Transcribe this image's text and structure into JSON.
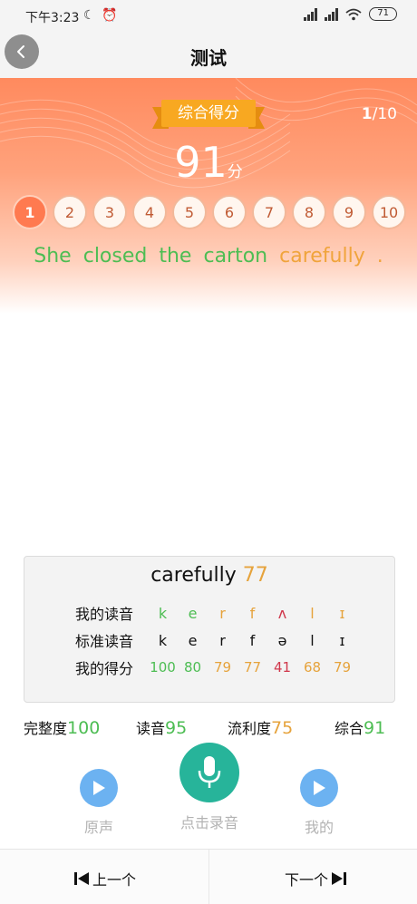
{
  "status_bar": {
    "time": "下午3:23",
    "icons": [
      "moon-icon",
      "alarm-icon",
      "signal-icon",
      "signal-icon",
      "wifi-icon"
    ],
    "battery": "71"
  },
  "header": {
    "title": "测试",
    "back_icon": "chevron-left-icon"
  },
  "result": {
    "badge": "综合得分",
    "progress_current": "1",
    "progress_total": "/10",
    "score": "91",
    "score_unit": "分",
    "questions": [
      "1",
      "2",
      "3",
      "4",
      "5",
      "6",
      "7",
      "8",
      "9",
      "10"
    ],
    "active_question": "1",
    "sentence": [
      {
        "text": "She",
        "color": "#4dbd53"
      },
      {
        "text": "closed",
        "color": "#4dbd53"
      },
      {
        "text": "the",
        "color": "#4dbd53"
      },
      {
        "text": "carton",
        "color": "#4dbd53"
      },
      {
        "text": "carefully",
        "color": "#f0a43c"
      },
      {
        "text": ".",
        "color": "#f0a43c"
      }
    ]
  },
  "detail": {
    "word": "carefully",
    "word_score": "77",
    "my_label": "我的读音",
    "std_label": "标准读音",
    "score_label": "我的得分",
    "my_phonemes": [
      "k",
      "e",
      "r",
      "f",
      "ʌ",
      "l",
      "ɪ"
    ],
    "my_colors": [
      "#4dbd53",
      "#4dbd53",
      "#e6a33c",
      "#e6a33c",
      "#d0384c",
      "#e6a33c",
      "#e6a33c"
    ],
    "std_phonemes": [
      "k",
      "e",
      "r",
      "f",
      "ə",
      "l",
      "ɪ"
    ],
    "scores": [
      "100",
      "80",
      "79",
      "77",
      "41",
      "68",
      "79"
    ],
    "score_colors": [
      "#4dbd53",
      "#4dbd53",
      "#e6a33c",
      "#e6a33c",
      "#d0384c",
      "#e6a33c",
      "#e6a33c"
    ]
  },
  "metrics": {
    "completeness_label": "完整度",
    "completeness": "100",
    "pronunciation_label": "读音",
    "pronunciation": "95",
    "fluency_label": "流利度",
    "fluency": "75",
    "overall_label": "综合",
    "overall": "91"
  },
  "actions": {
    "original_label": "原声",
    "record_label": "点击录音",
    "mine_label": "我的"
  },
  "bottom_nav": {
    "prev_label": "上一个",
    "next_label": "下一个"
  }
}
